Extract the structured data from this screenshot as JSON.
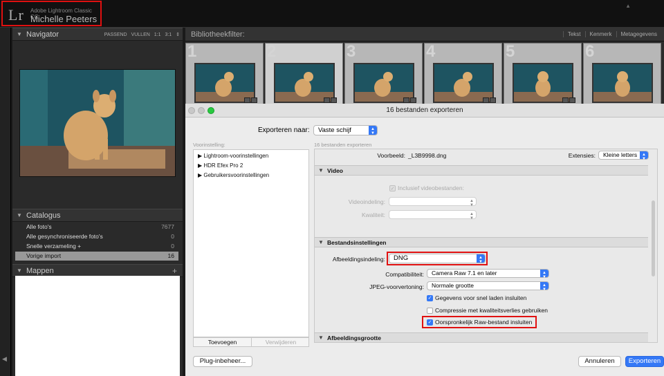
{
  "app": {
    "product": "Adobe Lightroom Classic CC",
    "user": "Michelle Peeters",
    "logo": "Lr"
  },
  "navigator": {
    "title": "Navigator",
    "options": [
      "PASSEND",
      "VULLEN",
      "1:1",
      "3:1"
    ]
  },
  "catalog": {
    "title": "Catalogus",
    "rows": [
      {
        "label": "Alle foto's",
        "count": "7677"
      },
      {
        "label": "Alle gesynchroniseerde foto's",
        "count": "0"
      },
      {
        "label": "Snelle verzameling +",
        "count": "0"
      },
      {
        "label": "Vorige import",
        "count": "16"
      }
    ]
  },
  "folders": {
    "title": "Mappen",
    "plus": "+"
  },
  "library": {
    "filter_label": "Bibliotheekfilter:",
    "filter_tabs": [
      "Tekst",
      "Kenmerk",
      "Metagegevens"
    ],
    "thumbnails": [
      "1",
      "2",
      "3",
      "4",
      "5",
      "6"
    ]
  },
  "dialog": {
    "title": "16 bestanden exporteren",
    "export_to_label": "Exporteren naar:",
    "export_to_value": "Vaste schijf",
    "preset_label": "Voorinstelling:",
    "files_label": "16 bestanden exporteren",
    "presets": [
      "Lightroom-voorinstellingen",
      "HDR Efex Pro 2",
      "Gebruikersvoorinstellingen"
    ],
    "add_button": "Toevoegen",
    "remove_button": "Verwijderen",
    "preview_label": "Voorbeeld:",
    "preview_value": "_L3B9998.dng",
    "extensions_label": "Extensies:",
    "extensions_value": "Kleine letters",
    "video": {
      "title": "Video",
      "include_label": "Inclusief videobestanden:",
      "format_label": "Videoindeling:",
      "quality_label": "Kwaliteit:"
    },
    "file_settings": {
      "title": "Bestandsinstellingen",
      "format_label": "Afbeeldingsindeling:",
      "format_value": "DNG",
      "compat_label": "Compatibiliteit:",
      "compat_value": "Camera Raw 7.1 en later",
      "jpeg_label": "JPEG-voorvertoning:",
      "jpeg_value": "Normale grootte",
      "options": [
        {
          "label": "Gegevens voor snel laden insluiten",
          "checked": true
        },
        {
          "label": "Compressie met kwaliteitsverlies gebruiken",
          "checked": false
        },
        {
          "label": "Oorspronkelijk Raw-bestand insluiten",
          "checked": true
        }
      ]
    },
    "image_size": {
      "title": "Afbeeldingsgrootte"
    },
    "plugin_button": "Plug-inbeheer...",
    "cancel_button": "Annuleren",
    "export_button": "Exporteren"
  },
  "colors": {
    "highlight_red": "#e01010",
    "accent_blue": "#3478f6"
  }
}
